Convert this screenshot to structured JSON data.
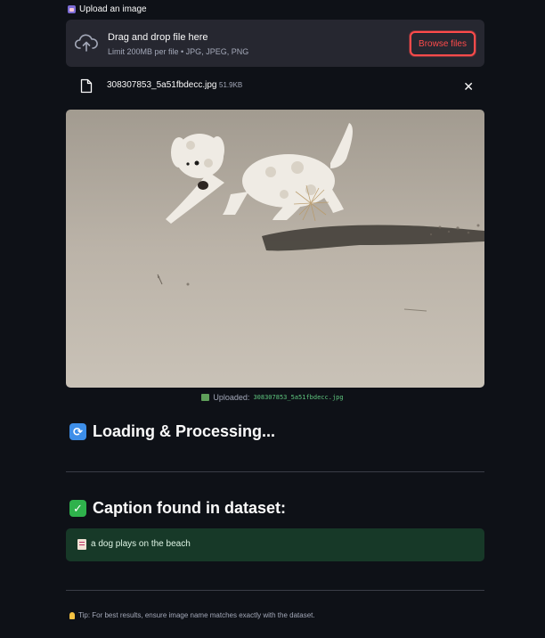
{
  "uploader": {
    "label": "Upload an image",
    "dropzone_title": "Drag and drop file here",
    "limit_text": "Limit 200MB per file • JPG, JPEG, PNG",
    "browse_label": "Browse files"
  },
  "file": {
    "name": "308307853_5a51fbdecc.jpg",
    "size": "51.9KB",
    "close_glyph": "✕"
  },
  "uploaded_caption": {
    "prefix": "Uploaded:",
    "filename": "308307853_5a51fbdecc.jpg"
  },
  "loading": {
    "icon_glyph": "⟳",
    "title": "Loading & Processing..."
  },
  "result": {
    "icon_glyph": "✓",
    "title": "Caption found in dataset:",
    "caption": "a dog plays on the beach"
  },
  "tip": {
    "text": "Tip: For best results, ensure image name matches exactly with the dataset."
  },
  "colors": {
    "background": "#0e1117",
    "accent": "#ff4b4b",
    "success_bg": "#173928",
    "loading_icon": "#3d8ee8",
    "success_icon": "#2fb24c"
  },
  "icons": [
    "picture-label-icon",
    "cloud-upload-icon",
    "file-icon",
    "close-icon",
    "image-icon",
    "refresh-icon",
    "check-icon",
    "memo-icon",
    "lightbulb-icon"
  ]
}
